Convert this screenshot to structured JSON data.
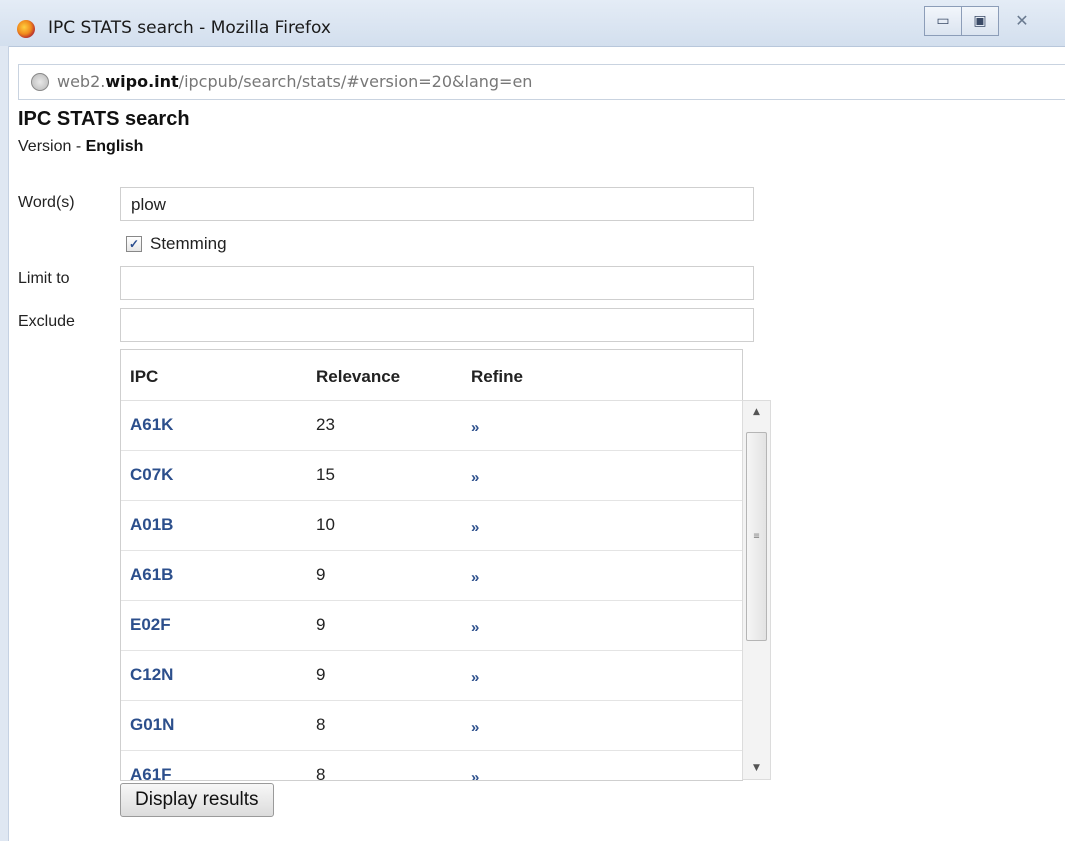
{
  "window": {
    "title": "IPC STATS search - Mozilla Firefox",
    "minimize": "▭",
    "maximize": "▣",
    "close": "✕"
  },
  "address": {
    "prefix": "web2.",
    "domain": "wipo.int",
    "path": "/ipcpub/search/stats/#version=20&lang=en"
  },
  "page": {
    "title": "IPC STATS search",
    "version_label": "Version  - ",
    "version_value": "English"
  },
  "form": {
    "words_label": "Word(s)",
    "words_value": "plow",
    "stemming_label": "Stemming",
    "stemming_checked": true,
    "limit_label": "Limit to",
    "limit_value": "",
    "exclude_label": "Exclude",
    "exclude_value": ""
  },
  "results": {
    "headers": {
      "ipc": "IPC",
      "relevance": "Relevance",
      "refine": "Refine"
    },
    "rows": [
      {
        "ipc": "A61K",
        "relevance": "23",
        "refine": "»"
      },
      {
        "ipc": "C07K",
        "relevance": "15",
        "refine": "»"
      },
      {
        "ipc": "A01B",
        "relevance": "10",
        "refine": "»"
      },
      {
        "ipc": "A61B",
        "relevance": "9",
        "refine": "»"
      },
      {
        "ipc": "E02F",
        "relevance": "9",
        "refine": "»"
      },
      {
        "ipc": "C12N",
        "relevance": "9",
        "refine": "»"
      },
      {
        "ipc": "G01N",
        "relevance": "8",
        "refine": "»"
      },
      {
        "ipc": "A61F",
        "relevance": "8",
        "refine": "»"
      }
    ]
  },
  "display_button": "Display results",
  "colors": {
    "link": "#2c4f8c"
  }
}
